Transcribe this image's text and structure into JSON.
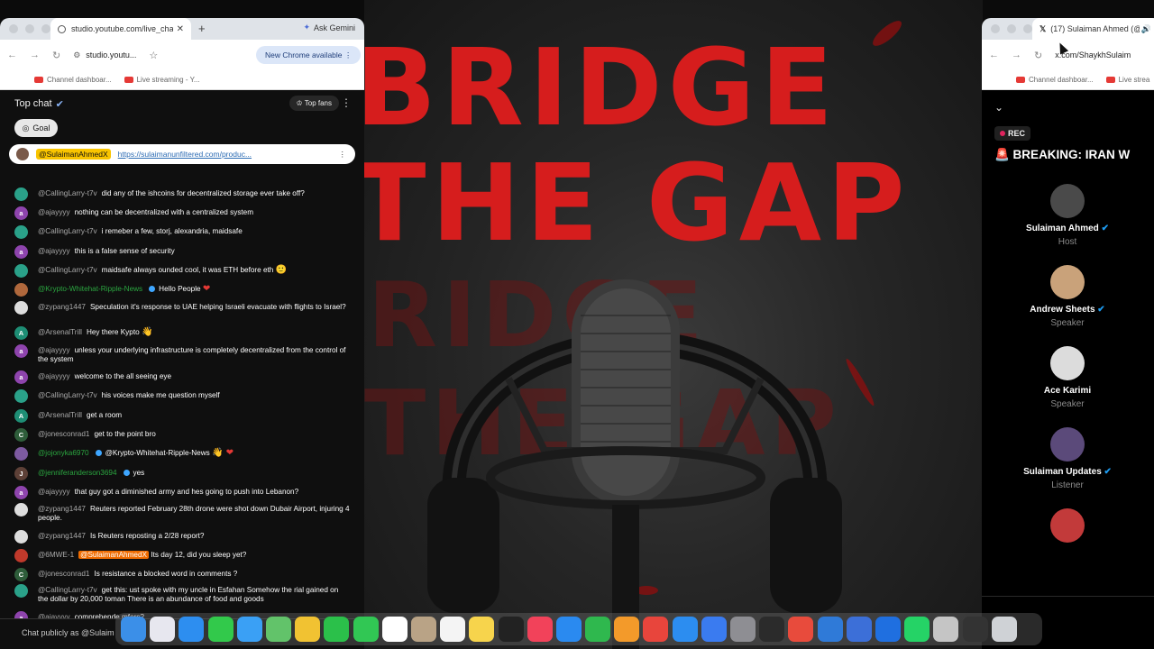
{
  "poster": {
    "line1": "BRIDGE",
    "line2": "THE GAP",
    "ghost1": "RIDGE",
    "ghost2": "THE GAP"
  },
  "chat_window": {
    "tab_title": "studio.youtube.com/live_cha",
    "new_tab": "+",
    "ask_gemini": "Ask Gemini",
    "address": "studio.youtu...",
    "new_chrome": "New Chrome available",
    "bookmarks": [
      "Channel dashboar...",
      "Live streaming - Y..."
    ],
    "chat_title": "Top chat",
    "top_fans": "Top fans",
    "goal": "Goal",
    "pinned": {
      "author": "@SulaimanAhmedX",
      "link": "https://sulaimanunfiltered.com/produc..."
    },
    "input_placeholder": "Chat publicly as @Sulaim",
    "messages": [
      {
        "author": "@CallingLarry-t7v",
        "text": "did any of the ishcoins for decentralized storage ever take off?",
        "avatar": "",
        "color": "#2aa189"
      },
      {
        "author": "@ajayyyy",
        "text": "nothing can be decentralized with a centralized system",
        "avatar": "a",
        "color": "#8e44ad"
      },
      {
        "author": "@CallingLarry-t7v",
        "text": "i remeber a few, storj, alexandria, maidsafe",
        "avatar": "",
        "color": "#2aa189"
      },
      {
        "author": "@ajayyyy",
        "text": "this is a false sense of security",
        "avatar": "a",
        "color": "#8e44ad"
      },
      {
        "author": "@CallingLarry-t7v",
        "text": "maidsafe always ounded cool, it was ETH before eth",
        "emoji": "🙂",
        "avatar": "",
        "color": "#2aa189"
      },
      {
        "author": "@Krypto-Whitehat-Ripple-News",
        "text": "Hello People",
        "emoji": "❤",
        "avatar": "",
        "color": "#b0683c",
        "green": true,
        "mod": true
      },
      {
        "author": "@zypang1447",
        "text": "Speculation it's response to UAE helping Israeli evacuate with flights to Israel?",
        "avatar": "",
        "color": "#dddddd"
      },
      {
        "author": "@ArsenalTrill",
        "text": "Hey there Kypto",
        "emoji": "👋",
        "avatar": "A",
        "color": "#1e8e75"
      },
      {
        "author": "@ajayyyy",
        "text": "unless your underlying infrastructure is completely decentralized from the control of the system",
        "avatar": "a",
        "color": "#8e44ad"
      },
      {
        "author": "@ajayyyy",
        "text": "welcome to the all seeing eye",
        "avatar": "a",
        "color": "#8e44ad"
      },
      {
        "author": "@CallingLarry-t7v",
        "text": "his voices make me question myself",
        "avatar": "",
        "color": "#2aa189"
      },
      {
        "author": "@ArsenalTrill",
        "text": "get a room",
        "avatar": "A",
        "color": "#1e8e75"
      },
      {
        "author": "@jonesconrad1",
        "text": "get to the point bro",
        "avatar": "C",
        "color": "#2e5d3a"
      },
      {
        "author": "@jojonyka6970",
        "text": "@Krypto-Whitehat-Ripple-News",
        "emoji": "👋 ❤",
        "avatar": "",
        "color": "#7d5aa0",
        "green": true,
        "mod": true
      },
      {
        "author": "@jenniferanderson3694",
        "text": "yes",
        "avatar": "J",
        "color": "#5d4037",
        "green": true,
        "mod": true
      },
      {
        "author": "@ajayyyy",
        "text": "that guy got a diminished army and hes going to push into Lebanon?",
        "avatar": "a",
        "color": "#8e44ad"
      },
      {
        "author": "@zypang1447",
        "text": "Reuters reported February 28th drone were shot down Dubair Airport, injuring 4 people.",
        "avatar": "",
        "color": "#dddddd"
      },
      {
        "author": "@zypang1447",
        "text": "Is Reuters reposting a 2/28 report?",
        "avatar": "",
        "color": "#dddddd"
      },
      {
        "author": "@6MWE-1",
        "mention": "@SulaimanAhmedX",
        "text": "Its day 12, did you sleep yet?",
        "avatar": "",
        "color": "#c0392b"
      },
      {
        "author": "@jonesconrad1",
        "text": "Is resistance a blocked word in comments ?",
        "avatar": "C",
        "color": "#2e5d3a"
      },
      {
        "author": "@CallingLarry-t7v",
        "text": "get this: ust spoke with my uncle in Esfahan Somehow the rial gained on the dollar by 20,000 toman There is an abundance of food and goods",
        "avatar": "",
        "color": "#2aa189"
      },
      {
        "author": "@ajayyyy",
        "text": "comprehende mfers?",
        "avatar": "a",
        "color": "#8e44ad"
      }
    ]
  },
  "x_window": {
    "tab_title": "(17) Sulaiman Ahmed (@S",
    "address": "x.com/ShaykhSulaim",
    "bookmarks": [
      "Channel dashboar...",
      "Live strea"
    ],
    "rec": "REC",
    "breaking": "🚨 BREAKING: IRAN W",
    "speakers": [
      {
        "name": "Sulaiman Ahmed",
        "role": "Host",
        "color": "#4a4a4a",
        "verified": true
      },
      {
        "name": "Andrew Sheets",
        "role": "Speaker",
        "color": "#c9a27a",
        "verified": true
      },
      {
        "name": "Ace Karimi",
        "role": "Speaker",
        "color": "#dcdcdc",
        "verified": false
      },
      {
        "name": "Sulaiman Updates",
        "role": "Listener",
        "color": "#5b4a7a",
        "verified": true
      },
      {
        "name": "",
        "role": "",
        "color": "#c23a3a",
        "verified": false
      }
    ]
  },
  "dock": {
    "icons": [
      {
        "name": "finder-icon",
        "color": "#3b8fe8"
      },
      {
        "name": "launchpad-icon",
        "color": "#e7e7ef"
      },
      {
        "name": "safari-icon",
        "color": "#2d8ef0"
      },
      {
        "name": "messages-icon",
        "color": "#32c94b"
      },
      {
        "name": "mail-icon",
        "color": "#3aa0f5"
      },
      {
        "name": "maps-icon",
        "color": "#62c36a"
      },
      {
        "name": "photos-icon",
        "color": "#f1c232"
      },
      {
        "name": "facetime-icon",
        "color": "#2bc04a"
      },
      {
        "name": "phone-icon",
        "color": "#31c754"
      },
      {
        "name": "calendar-icon",
        "color": "#ffffff"
      },
      {
        "name": "contacts-icon",
        "color": "#b9a386"
      },
      {
        "name": "reminders-icon",
        "color": "#f4f4f4"
      },
      {
        "name": "notes-icon",
        "color": "#f7d44c"
      },
      {
        "name": "tv-icon",
        "color": "#222222"
      },
      {
        "name": "music-icon",
        "color": "#f2425a"
      },
      {
        "name": "keynote-icon",
        "color": "#2a8af0"
      },
      {
        "name": "numbers-icon",
        "color": "#2fb84e"
      },
      {
        "name": "pages-icon",
        "color": "#f39a2a"
      },
      {
        "name": "rocket-icon",
        "color": "#e8453c"
      },
      {
        "name": "appstore-icon",
        "color": "#2c8df0"
      },
      {
        "name": "files-icon",
        "color": "#3a7bf0"
      },
      {
        "name": "settings-icon",
        "color": "#8e8e93"
      },
      {
        "name": "obs-icon",
        "color": "#2b2b2b"
      },
      {
        "name": "chrome-icon",
        "color": "#e84b3c"
      },
      {
        "name": "safari-tech-icon",
        "color": "#2f7ad8"
      },
      {
        "name": "preview-icon",
        "color": "#3c6fd8"
      },
      {
        "name": "quicktime-icon",
        "color": "#1f6fe0"
      },
      {
        "name": "whatsapp-icon",
        "color": "#25d366"
      },
      {
        "name": "screenshot-icon",
        "color": "#c5c5c5"
      },
      {
        "name": "terminal-icon",
        "color": "#333333"
      },
      {
        "name": "trash-icon",
        "color": "#cfd2d6"
      }
    ]
  }
}
